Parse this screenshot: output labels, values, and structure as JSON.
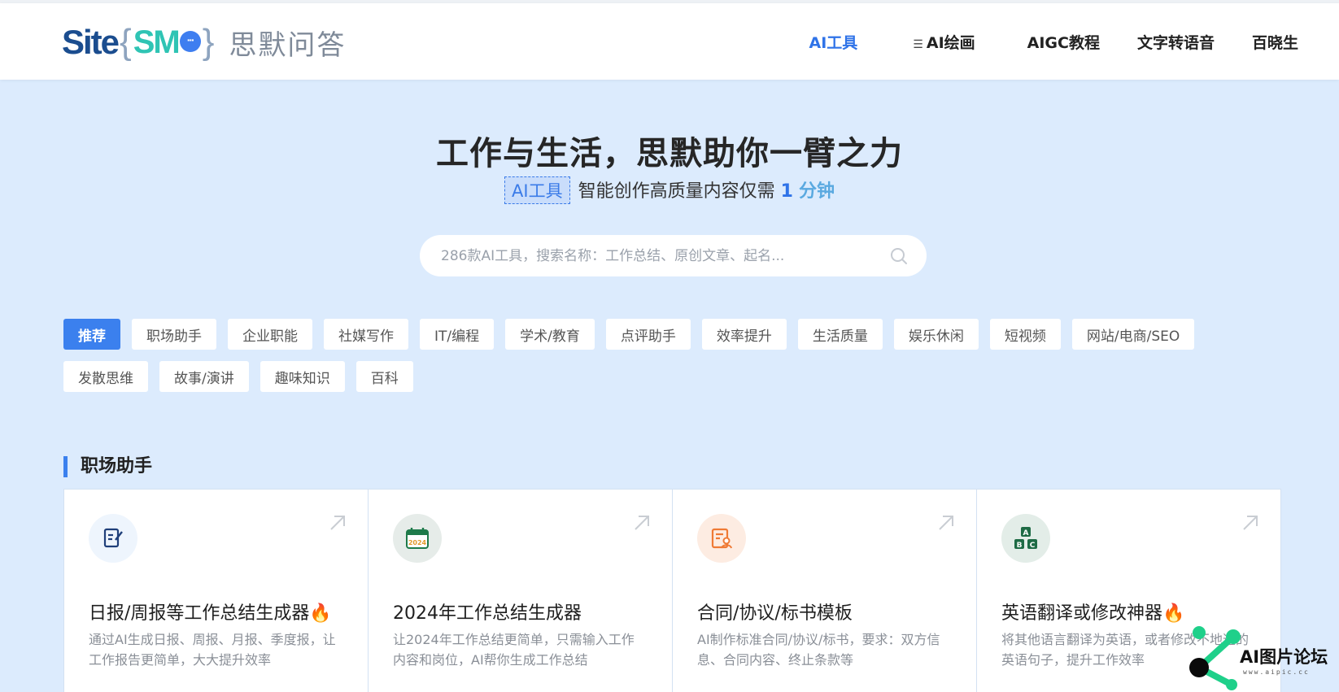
{
  "header": {
    "logo_site": "Site",
    "logo_brace_open": "{",
    "logo_smo": "SM",
    "logo_bubble": "···",
    "logo_brace_close": "}",
    "logo_cn": "思默问答",
    "nav": [
      {
        "label": "AI工具",
        "active": true
      },
      {
        "label": "AI绘画",
        "active": false,
        "icon": "menu-icon"
      },
      {
        "label": "AIGC教程",
        "active": false
      },
      {
        "label": "文字转语音",
        "active": false
      },
      {
        "label": "百晓生",
        "active": false
      }
    ]
  },
  "hero": {
    "title": "工作与生活，思默助你一臂之力",
    "tag": "AI工具",
    "sub_text": "智能创作高质量内容仅需",
    "number": "1",
    "unit": "分钟"
  },
  "search": {
    "placeholder": "286款AI工具，搜索名称：工作总结、原创文章、起名...",
    "value": ""
  },
  "categories": {
    "row1": [
      "推荐",
      "职场助手",
      "企业职能",
      "社媒写作",
      "IT/编程",
      "学术/教育",
      "点评助手",
      "效率提升",
      "生活质量",
      "娱乐休闲",
      "短视频",
      "网站/电商/SEO"
    ],
    "row2": [
      "发散思维",
      "故事/演讲",
      "趣味知识",
      "百科"
    ],
    "active": "推荐"
  },
  "section": {
    "title": "职场助手",
    "cards": [
      {
        "title": "日报/周报等工作总结生成器🔥",
        "desc": "通过AI生成日报、周报、月报、季度报，让工作报告更简单，大大提升效率",
        "icon": "edit-document-icon",
        "icon_bg": "#eef5fd",
        "icon_color": "#1f3f7a"
      },
      {
        "title": "2024年工作总结生成器",
        "desc": "让2024年工作总结更简单，只需输入工作内容和岗位，AI帮你生成工作总结",
        "icon": "calendar-2024-icon",
        "icon_bg": "#e6ece9",
        "icon_color": "#1e7a4a"
      },
      {
        "title": "合同/协议/标书模板",
        "desc": "AI制作标准合同/协议/标书，要求：双方信息、合同内容、终止条款等",
        "icon": "contract-icon",
        "icon_bg": "#fdece2",
        "icon_color": "#ef7a35"
      },
      {
        "title": "英语翻译或修改神器🔥",
        "desc": "将其他语言翻译为英语，或者修改不地道的英语句子，提升工作效率",
        "icon": "abc-blocks-icon",
        "icon_bg": "#e3ede8",
        "icon_color": "#1e6b45"
      }
    ]
  },
  "watermark": {
    "text": "AI图片论坛",
    "sub": "www.aipic.cc"
  }
}
